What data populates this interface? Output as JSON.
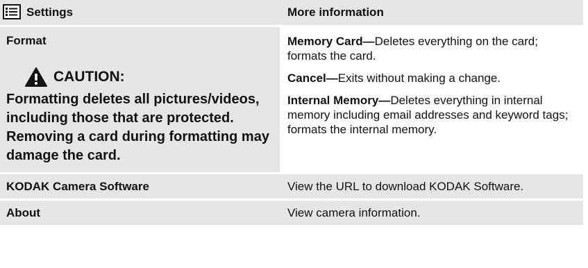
{
  "header": {
    "settings_label": "Settings",
    "info_label": "More information"
  },
  "rows": {
    "format": {
      "name": "Format",
      "caution_title": "CAUTION:",
      "caution_text": "Formatting deletes all pictures/videos, including those that are protected. Removing a card during formatting may damage the card.",
      "info": [
        {
          "term": "Memory Card—",
          "desc": "Deletes everything on the card; formats the card."
        },
        {
          "term": "Cancel—",
          "desc": "Exits without making a change."
        },
        {
          "term": "Internal Memory—",
          "desc": "Deletes everything in internal memory including email addresses and keyword tags; formats the internal memory."
        }
      ]
    },
    "software": {
      "name": "KODAK Camera Software",
      "info": "View the URL to download KODAK Software."
    },
    "about": {
      "name": "About",
      "info": "View camera information."
    }
  },
  "icons": {
    "menu": "menu-icon",
    "caution": "warning-triangle-icon"
  }
}
